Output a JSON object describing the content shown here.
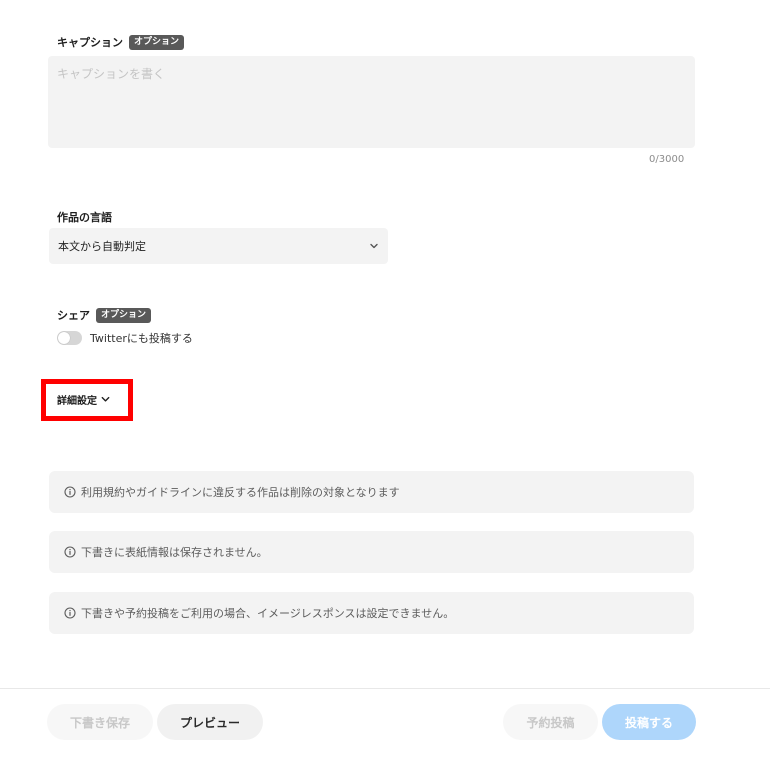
{
  "caption": {
    "label": "キャプション",
    "badge": "オプション",
    "placeholder": "キャプションを書く",
    "counter": "0/3000"
  },
  "language": {
    "label": "作品の言語",
    "selected": "本文から自動判定"
  },
  "share": {
    "label": "シェア",
    "badge": "オプション",
    "toggle_label": "Twitterにも投稿する"
  },
  "advanced": {
    "label": "詳細設定"
  },
  "notices": [
    "利用規約やガイドラインに違反する作品は削除の対象となります",
    "下書きに表紙情報は保存されません。",
    "下書きや予約投稿をご利用の場合、イメージレスポンスは設定できません。"
  ],
  "footer": {
    "draft_save": "下書き保存",
    "preview": "プレビュー",
    "schedule": "予約投稿",
    "post": "投稿する"
  },
  "colors": {
    "highlight": "#ff0000",
    "post_button": "#aed6fb"
  }
}
